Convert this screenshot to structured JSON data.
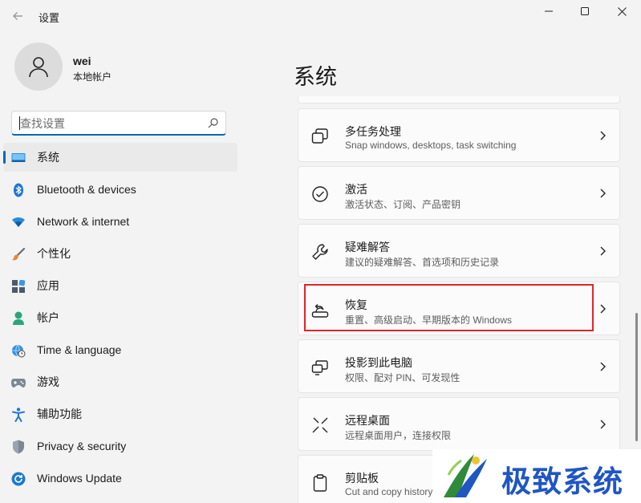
{
  "window": {
    "title": "设置"
  },
  "user": {
    "name": "wei",
    "account_type": "本地帐户"
  },
  "search": {
    "placeholder": "查找设置"
  },
  "nav": [
    {
      "label": "系统",
      "icon": "system-display-icon",
      "active": true
    },
    {
      "label": "Bluetooth & devices",
      "icon": "bluetooth-icon"
    },
    {
      "label": "Network & internet",
      "icon": "wifi-icon"
    },
    {
      "label": "个性化",
      "icon": "brush-icon"
    },
    {
      "label": "应用",
      "icon": "apps-icon"
    },
    {
      "label": "帐户",
      "icon": "account-icon"
    },
    {
      "label": "Time & language",
      "icon": "globe-clock-icon"
    },
    {
      "label": "游戏",
      "icon": "gamepad-icon"
    },
    {
      "label": "辅助功能",
      "icon": "accessibility-icon"
    },
    {
      "label": "Privacy & security",
      "icon": "shield-icon"
    },
    {
      "label": "Windows Update",
      "icon": "windows-update-icon"
    }
  ],
  "main": {
    "title": "系统",
    "cards": [
      {
        "title": "多任务处理",
        "subtitle": "Snap windows, desktops, task switching",
        "icon": "multitasking-icon"
      },
      {
        "title": "激活",
        "subtitle": "激活状态、订阅、产品密钥",
        "icon": "activation-check-icon"
      },
      {
        "title": "疑难解答",
        "subtitle": "建议的疑难解答、首选项和历史记录",
        "icon": "wrench-icon"
      },
      {
        "title": "恢复",
        "subtitle": "重置、高级启动、早期版本的 Windows",
        "icon": "recovery-icon",
        "highlighted": true
      },
      {
        "title": "投影到此电脑",
        "subtitle": "权限、配对 PIN、可发现性",
        "icon": "project-screen-icon"
      },
      {
        "title": "远程桌面",
        "subtitle": "远程桌面用户，连接权限",
        "icon": "remote-desktop-icon"
      },
      {
        "title": "剪贴板",
        "subtitle": "Cut and copy history",
        "icon": "clipboard-icon"
      }
    ]
  },
  "watermark": {
    "text": "极致系统"
  },
  "colors": {
    "accent": "#0067c0",
    "highlight": "#e0242c",
    "watermark": "#1f56c4"
  }
}
